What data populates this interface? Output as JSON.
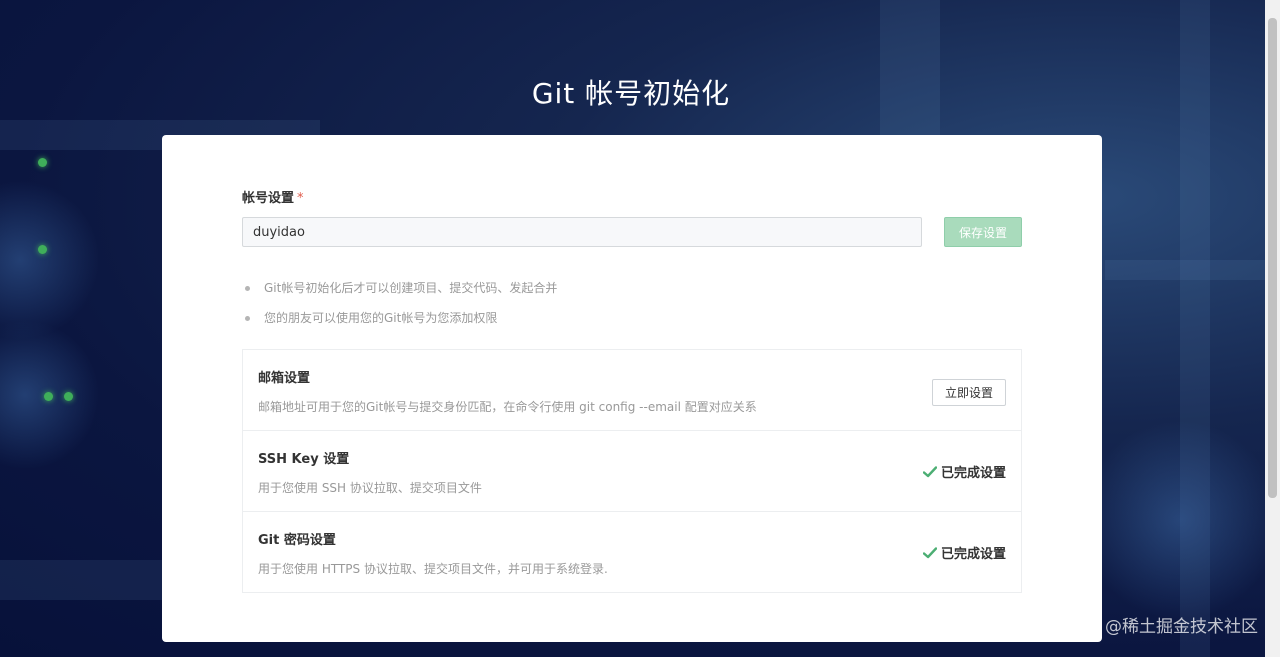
{
  "page": {
    "title": "Git 帐号初始化"
  },
  "account": {
    "label": "帐号设置",
    "required_mark": "*",
    "username_value": "duyidao",
    "save_label": "保存设置"
  },
  "tips": [
    "Git帐号初始化后才可以创建项目、提交代码、发起合并",
    "您的朋友可以使用您的Git帐号为您添加权限"
  ],
  "settings": [
    {
      "title": "邮箱设置",
      "description": "邮箱地址可用于您的Git帐号与提交身份匹配，在命令行使用 git config --email 配置对应关系",
      "action_label": "立即设置"
    },
    {
      "title": "SSH Key 设置",
      "description": "用于您使用 SSH 协议拉取、提交项目文件",
      "status_label": "已完成设置"
    },
    {
      "title": "Git 密码设置",
      "description": "用于您使用 HTTPS 协议拉取、提交项目文件，并可用于系统登录.",
      "status_label": "已完成设置"
    }
  ],
  "watermark": "@稀土掘金技术社区",
  "colors": {
    "success": "#4cae73",
    "save_button_disabled": "#a9dbbc",
    "background": "#0b1640"
  }
}
